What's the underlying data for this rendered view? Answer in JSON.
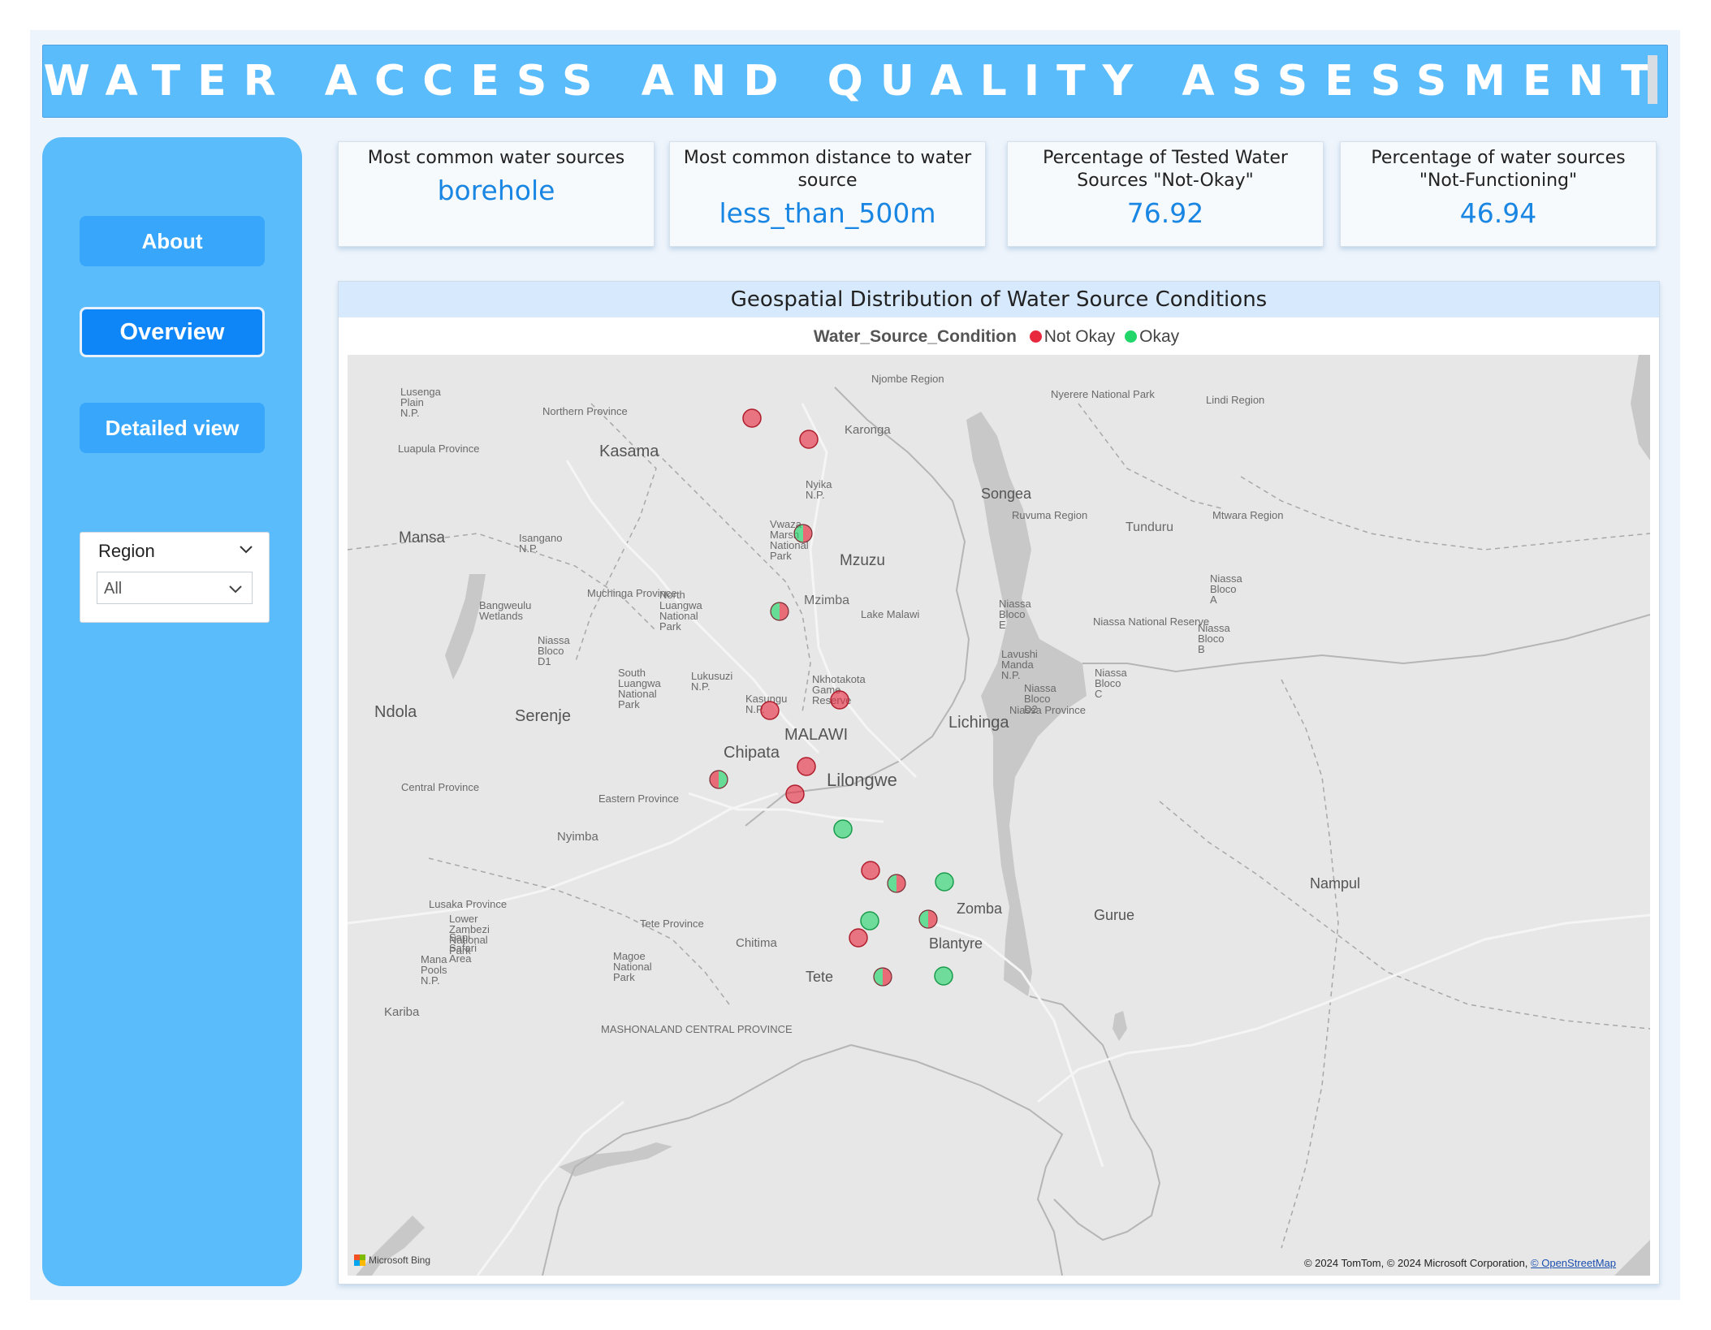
{
  "banner": {
    "title": "WATER  ACCESS AND QUALITY ASSESSMENT"
  },
  "nav": {
    "about": "About",
    "overview": "Overview",
    "detailed": "Detailed view"
  },
  "slicer": {
    "header": "Region",
    "value": "All"
  },
  "cards": [
    {
      "label": "Most common water sources",
      "value": "borehole"
    },
    {
      "label": "Most common distance to water source",
      "value": "less_than_500m"
    },
    {
      "label": "Percentage of Tested Water Sources \"Not-Okay\"",
      "value": "76.92"
    },
    {
      "label": "Percentage of water sources \"Not-Functioning\"",
      "value": "46.94"
    }
  ],
  "map": {
    "title": "Geospatial Distribution of Water Source Conditions",
    "legend_title": "Water_Source_Condition",
    "legend_items": [
      {
        "label": "Not Okay",
        "color": "#e8283c"
      },
      {
        "label": "Okay",
        "color": "#22d66a"
      }
    ],
    "attribution": "© 2024 TomTom, © 2024 Microsoft Corporation, ",
    "attribution_link": "© OpenStreetMap",
    "provider": "Microsoft Bing",
    "labels": [
      "Lusenga Plain N.P.",
      "Northern Province",
      "Njombe Region",
      "Nyerere National Park",
      "Lindi Region",
      "Karonga",
      "Kasama",
      "Luapula Province",
      "Nyika N.P.",
      "Songea",
      "Ruvuma Region",
      "Tunduru",
      "Mtwara Region",
      "Mansa",
      "Isangano N.P.",
      "Vwaza Marsh National Park",
      "Mzuzu",
      "Niassa Bloco A",
      "Bangweulu Wetlands",
      "Muchinga Province",
      "North Luangwa National Park",
      "Mzimba",
      "Lake Malawi",
      "Niassa Bloco E",
      "Niassa National Reserve",
      "Niassa Bloco B",
      "Lavushi Manda N.P.",
      "Niassa Bloco D1",
      "Niassa Bloco C",
      "South Luangwa National Park",
      "Lukusuzi N.P.",
      "Nkhotakota Game Reserve",
      "Niassa Bloco D2",
      "Niassa Province",
      "Ndola",
      "Serenje",
      "Kasungu N.P.",
      "Lichinga",
      "MALAWI",
      "Chipata",
      "Lilongwe",
      "Central Province",
      "Eastern Province",
      "Nyimba",
      "Nampul",
      "Zomba",
      "Lusaka Province",
      "Lower Zambezi National Park",
      "Tete Province",
      "Gurue",
      "Sapi Safari Area",
      "Mana Pools N.P.",
      "Magoe National Park",
      "Chitima",
      "Blantyre",
      "Tete",
      "Kariba",
      "MASHONALAND CENTRAL PROVINCE"
    ],
    "points": [
      {
        "cond": [
          "not_okay"
        ]
      },
      {
        "cond": [
          "not_okay"
        ]
      },
      {
        "cond": [
          "okay",
          "not_okay"
        ]
      },
      {
        "cond": [
          "okay",
          "not_okay"
        ]
      },
      {
        "cond": [
          "not_okay"
        ]
      },
      {
        "cond": [
          "not_okay"
        ]
      },
      {
        "cond": [
          "not_okay",
          "okay"
        ]
      },
      {
        "cond": [
          "not_okay"
        ]
      },
      {
        "cond": [
          "not_okay"
        ]
      },
      {
        "cond": [
          "okay"
        ]
      },
      {
        "cond": [
          "not_okay"
        ]
      },
      {
        "cond": [
          "okay",
          "not_okay"
        ]
      },
      {
        "cond": [
          "okay"
        ]
      },
      {
        "cond": [
          "okay"
        ]
      },
      {
        "cond": [
          "okay",
          "not_okay"
        ]
      },
      {
        "cond": [
          "not_okay"
        ]
      },
      {
        "cond": [
          "okay",
          "not_okay"
        ]
      },
      {
        "cond": [
          "okay"
        ]
      }
    ]
  }
}
